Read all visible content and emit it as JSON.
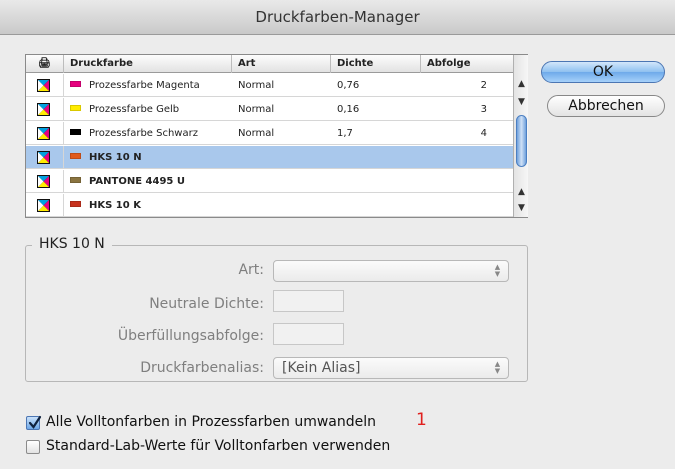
{
  "window": {
    "title": "Druckfarben-Manager"
  },
  "table": {
    "headers": {
      "print_icon": "🖨",
      "name": "Druckfarbe",
      "type": "Art",
      "density": "Dichte",
      "sequence": "Abfolge"
    },
    "rows": [
      {
        "name": "Prozessfarbe Magenta",
        "type": "Normal",
        "density": "0,76",
        "sequence": "2",
        "color": "#e6007e"
      },
      {
        "name": "Prozessfarbe Gelb",
        "type": "Normal",
        "density": "0,16",
        "sequence": "3",
        "color": "#ffec00"
      },
      {
        "name": "Prozessfarbe Schwarz",
        "type": "Normal",
        "density": "1,7",
        "sequence": "4",
        "color": "#000000"
      },
      {
        "name": "HKS 10 N",
        "type": "",
        "density": "",
        "sequence": "",
        "color": "#e05a1c",
        "selected": true
      },
      {
        "name": "PANTONE 4495 U",
        "type": "",
        "density": "",
        "sequence": "",
        "color": "#8a7440"
      },
      {
        "name": "HKS 10 K",
        "type": "",
        "density": "",
        "sequence": "",
        "color": "#c8321e"
      }
    ]
  },
  "buttons": {
    "ok": "OK",
    "cancel": "Abbrechen"
  },
  "details": {
    "title": "HKS 10 N",
    "type_label": "Art:",
    "type_value": "",
    "neutral_density_label": "Neutrale Dichte:",
    "neutral_density_value": "",
    "trapping_sequence_label": "Überfüllungsabfolge:",
    "trapping_sequence_value": "",
    "alias_label": "Druckfarbenalias:",
    "alias_value": "[Kein Alias]"
  },
  "options": {
    "convert_spot": {
      "label": "Alle Volltonfarben in Prozessfarben umwandeln",
      "checked": true
    },
    "use_lab": {
      "label": "Standard-Lab-Werte für Volltonfarben verwenden",
      "checked": false
    }
  },
  "annotation": "1",
  "colors": {
    "accent": "#6eaaea",
    "selection": "#a9c8ec",
    "annotation": "#e0201e"
  }
}
